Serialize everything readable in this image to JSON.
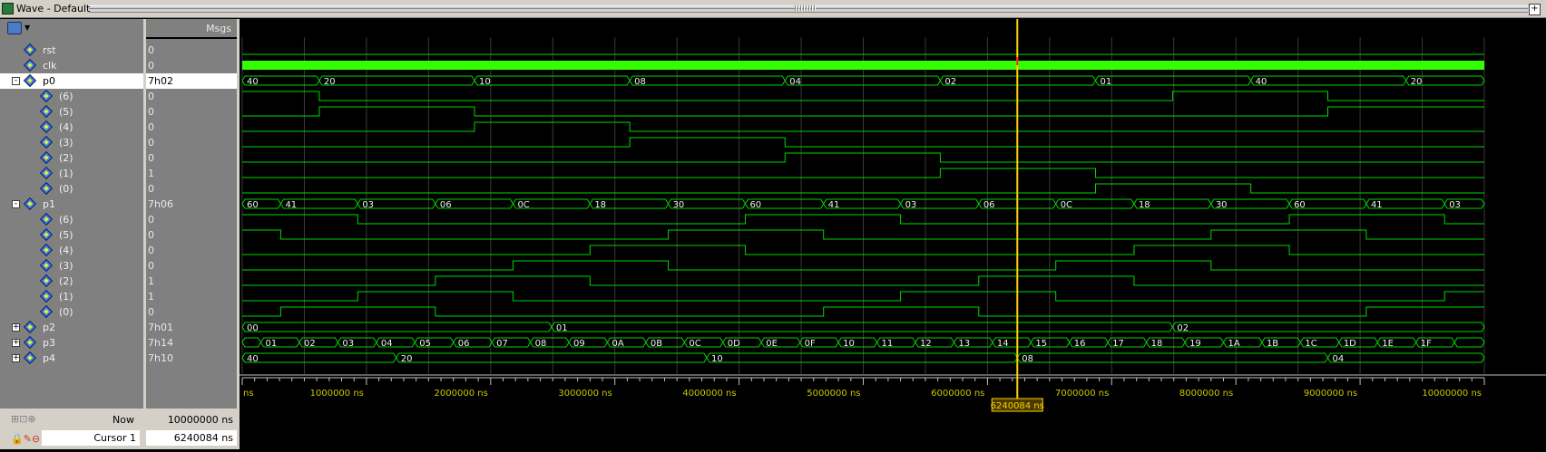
{
  "window": {
    "title": "Wave - Default"
  },
  "headers": {
    "msgs": "Msgs"
  },
  "signals": [
    {
      "name": "rst",
      "value": "0",
      "type": "bit",
      "tree": null
    },
    {
      "name": "clk",
      "value": "0",
      "type": "clock",
      "tree": null
    },
    {
      "name": "p0",
      "value": "7h02",
      "type": "bus",
      "tree": "-",
      "selected": true
    },
    {
      "name": "(6)",
      "value": "0",
      "type": "bit",
      "indent": true
    },
    {
      "name": "(5)",
      "value": "0",
      "type": "bit",
      "indent": true
    },
    {
      "name": "(4)",
      "value": "0",
      "type": "bit",
      "indent": true
    },
    {
      "name": "(3)",
      "value": "0",
      "type": "bit",
      "indent": true
    },
    {
      "name": "(2)",
      "value": "0",
      "type": "bit",
      "indent": true
    },
    {
      "name": "(1)",
      "value": "1",
      "type": "bit",
      "indent": true
    },
    {
      "name": "(0)",
      "value": "0",
      "type": "bit",
      "indent": true
    },
    {
      "name": "p1",
      "value": "7h06",
      "type": "bus",
      "tree": "-"
    },
    {
      "name": "(6)",
      "value": "0",
      "type": "bit",
      "indent": true
    },
    {
      "name": "(5)",
      "value": "0",
      "type": "bit",
      "indent": true
    },
    {
      "name": "(4)",
      "value": "0",
      "type": "bit",
      "indent": true
    },
    {
      "name": "(3)",
      "value": "0",
      "type": "bit",
      "indent": true
    },
    {
      "name": "(2)",
      "value": "1",
      "type": "bit",
      "indent": true
    },
    {
      "name": "(1)",
      "value": "1",
      "type": "bit",
      "indent": true
    },
    {
      "name": "(0)",
      "value": "0",
      "type": "bit",
      "indent": true
    },
    {
      "name": "p2",
      "value": "7h01",
      "type": "bus",
      "tree": "+"
    },
    {
      "name": "p3",
      "value": "7h14",
      "type": "bus",
      "tree": "+"
    },
    {
      "name": "p4",
      "value": "7h10",
      "type": "bus",
      "tree": "+"
    }
  ],
  "buses": {
    "p0": {
      "times": [
        0,
        620,
        1870,
        3120,
        4370,
        5620,
        6870,
        8120,
        9370
      ],
      "labels": [
        "40",
        "20",
        "10",
        "08",
        "04",
        "02",
        "01",
        "40",
        "20"
      ]
    },
    "p1": {
      "times": [
        0,
        310,
        930,
        1555,
        2180,
        2800,
        3430,
        4050,
        4680,
        5300,
        5930,
        6550,
        7180,
        7800,
        8430,
        9050,
        9680
      ],
      "labels": [
        "60",
        "41",
        "03",
        "06",
        "0C",
        "18",
        "30",
        "60",
        "41",
        "03",
        "06",
        "0C",
        "18",
        "30",
        "60",
        "41",
        "03"
      ]
    },
    "p2": {
      "times": [
        0,
        2490,
        7490
      ],
      "labels": [
        "00",
        "01",
        "02"
      ]
    },
    "p3": {
      "times": [
        0,
        150,
        460,
        770,
        1080,
        1390,
        1700,
        2010,
        2320,
        2630,
        2940,
        3250,
        3560,
        3870,
        4180,
        4490,
        4800,
        5110,
        5420,
        5730,
        6040,
        6350,
        6660,
        6970,
        7280,
        7590,
        7900,
        8210,
        8520,
        8830,
        9140,
        9450,
        9760
      ],
      "labels": [
        "",
        "01",
        "02",
        "03",
        "04",
        "05",
        "06",
        "07",
        "08",
        "09",
        "0A",
        "0B",
        "0C",
        "0D",
        "0E",
        "0F",
        "10",
        "11",
        "12",
        "13",
        "14",
        "15",
        "16",
        "17",
        "18",
        "19",
        "1A",
        "1B",
        "1C",
        "1D",
        "1E",
        "1F",
        ""
      ]
    },
    "p4": {
      "times": [
        0,
        1240,
        3740,
        6240,
        8740
      ],
      "labels": [
        "40",
        "20",
        "10",
        "08",
        "04"
      ]
    }
  },
  "bit_edges": {
    "rst": {
      "init": 0,
      "edges": []
    },
    "p0_6": {
      "init": 1,
      "edges": [
        620,
        7490,
        8740
      ]
    },
    "p0_5": {
      "init": 0,
      "edges": [
        620,
        1870,
        8740
      ]
    },
    "p0_4": {
      "init": 0,
      "edges": [
        1870,
        3120
      ]
    },
    "p0_3": {
      "init": 0,
      "edges": [
        3120,
        4370
      ]
    },
    "p0_2": {
      "init": 0,
      "edges": [
        4370,
        5620
      ]
    },
    "p0_1": {
      "init": 0,
      "edges": [
        5620,
        6870
      ]
    },
    "p0_0": {
      "init": 0,
      "edges": [
        6870,
        8120
      ]
    },
    "p1_6": {
      "init": 1,
      "edges": [
        930,
        4050,
        5300,
        8430,
        9680
      ]
    },
    "p1_5": {
      "init": 1,
      "edges": [
        310,
        3430,
        4680,
        7800,
        9050
      ]
    },
    "p1_4": {
      "init": 0,
      "edges": [
        2800,
        4050,
        7180,
        8430
      ]
    },
    "p1_3": {
      "init": 0,
      "edges": [
        2180,
        3430,
        6550,
        7800
      ]
    },
    "p1_2": {
      "init": 0,
      "edges": [
        1555,
        2800,
        5930,
        7180
      ]
    },
    "p1_1": {
      "init": 0,
      "edges": [
        930,
        2180,
        5300,
        6550,
        9680
      ]
    },
    "p1_0": {
      "init": 0,
      "edges": [
        310,
        1555,
        4680,
        5930,
        9050
      ]
    }
  },
  "time_axis": {
    "max_ns": 10000000,
    "ticks": [
      "1000000 ns",
      "2000000 ns",
      "3000000 ns",
      "4000000 ns",
      "5000000 ns",
      "6000000 ns",
      "7000000 ns",
      "8000000 ns",
      "9000000 ns",
      "10000000 ns"
    ],
    "start_label": "ns"
  },
  "cursor": {
    "time": 6240084,
    "label": "6240084 ns",
    "color": "#ffd200"
  },
  "bottom": {
    "now_label": "Now",
    "now_value": "10000000 ns",
    "cursor_label": "Cursor 1",
    "cursor_value": "6240084 ns"
  },
  "colors": {
    "wave": "#00d800",
    "clock": "#33ff00",
    "grid": "#3a3a3a",
    "cursor": "#ffd200"
  }
}
